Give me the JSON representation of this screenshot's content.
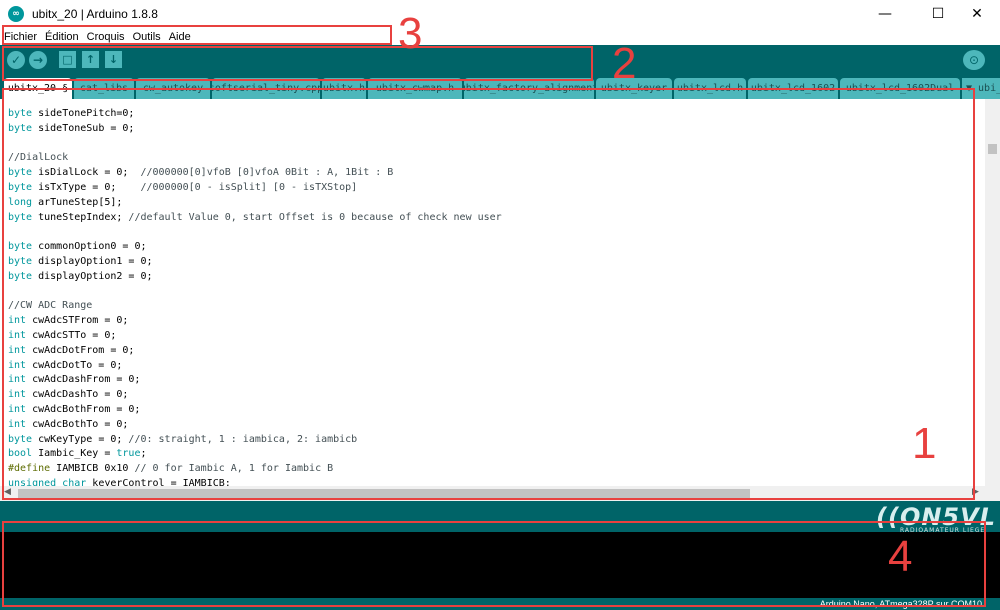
{
  "window": {
    "title": "ubitx_20 | Arduino 1.8.8",
    "minimize_glyph": "—",
    "maximize_glyph": "☐",
    "close_glyph": "✕"
  },
  "menu": [
    "Fichier",
    "Édition",
    "Croquis",
    "Outils",
    "Aide"
  ],
  "toolbar": {
    "verify_glyph": "✓",
    "upload_glyph": "→",
    "new_glyph": "□",
    "open_glyph": "↑",
    "save_glyph": "↓",
    "serial_glyph": "⊙"
  },
  "tabs": [
    "ubitx_20 §",
    "cat_libs",
    "cw_autokey",
    "softserial_tiny.cpp",
    "ubitx.h",
    "ubitx_cwmap.h",
    "ubitx_factory_alignment",
    "ubitx_keyer",
    "ubitx_lcd.h",
    "ubitx_lcd_1602",
    "ubitx_lcd_1602Dual",
    "▼ ubi_l"
  ],
  "code_lines": [
    [
      {
        "t": "byte",
        "c": "kw"
      },
      {
        "t": " sideTonePitch=0;"
      }
    ],
    [
      {
        "t": "byte",
        "c": "kw"
      },
      {
        "t": " sideToneSub = 0;"
      }
    ],
    [],
    [
      {
        "t": "//DialLock",
        "c": "cm"
      }
    ],
    [
      {
        "t": "byte",
        "c": "kw"
      },
      {
        "t": " isDialLock = 0;  "
      },
      {
        "t": "//000000[0]vfoB [0]vfoA 0Bit : A, 1Bit : B",
        "c": "cm"
      }
    ],
    [
      {
        "t": "byte",
        "c": "kw"
      },
      {
        "t": " isTxType = 0;    "
      },
      {
        "t": "//000000[0 - isSplit] [0 - isTXStop]",
        "c": "cm"
      }
    ],
    [
      {
        "t": "long",
        "c": "kw"
      },
      {
        "t": " arTuneStep[5];"
      }
    ],
    [
      {
        "t": "byte",
        "c": "kw"
      },
      {
        "t": " tuneStepIndex; "
      },
      {
        "t": "//default Value 0, start Offset is 0 because of check new user",
        "c": "cm"
      }
    ],
    [],
    [
      {
        "t": "byte",
        "c": "kw"
      },
      {
        "t": " commonOption0 = 0;"
      }
    ],
    [
      {
        "t": "byte",
        "c": "kw"
      },
      {
        "t": " displayOption1 = 0;"
      }
    ],
    [
      {
        "t": "byte",
        "c": "kw"
      },
      {
        "t": " displayOption2 = 0;"
      }
    ],
    [],
    [
      {
        "t": "//CW ADC Range",
        "c": "cm"
      }
    ],
    [
      {
        "t": "int",
        "c": "kw"
      },
      {
        "t": " cwAdcSTFrom = 0;"
      }
    ],
    [
      {
        "t": "int",
        "c": "kw"
      },
      {
        "t": " cwAdcSTTo = 0;"
      }
    ],
    [
      {
        "t": "int",
        "c": "kw"
      },
      {
        "t": " cwAdcDotFrom = 0;"
      }
    ],
    [
      {
        "t": "int",
        "c": "kw"
      },
      {
        "t": " cwAdcDotTo = 0;"
      }
    ],
    [
      {
        "t": "int",
        "c": "kw"
      },
      {
        "t": " cwAdcDashFrom = 0;"
      }
    ],
    [
      {
        "t": "int",
        "c": "kw"
      },
      {
        "t": " cwAdcDashTo = 0;"
      }
    ],
    [
      {
        "t": "int",
        "c": "kw"
      },
      {
        "t": " cwAdcBothFrom = 0;"
      }
    ],
    [
      {
        "t": "int",
        "c": "kw"
      },
      {
        "t": " cwAdcBothTo = 0;"
      }
    ],
    [
      {
        "t": "byte",
        "c": "kw"
      },
      {
        "t": " cwKeyType = 0; "
      },
      {
        "t": "//0: straight, 1 : iambica, 2: iambicb",
        "c": "cm"
      }
    ],
    [
      {
        "t": "bool",
        "c": "kw"
      },
      {
        "t": " Iambic_Key = "
      },
      {
        "t": "true",
        "c": "lit"
      },
      {
        "t": ";"
      }
    ],
    [
      {
        "t": "#define",
        "c": "pp"
      },
      {
        "t": " IAMBICB 0x10 "
      },
      {
        "t": "// 0 for Iambic A, 1 for Iambic B",
        "c": "cm"
      }
    ],
    [
      {
        "t": "unsigned char",
        "c": "kw"
      },
      {
        "t": " keyerControl = IAMBICB;"
      }
    ]
  ],
  "watermark": {
    "logo": "((ON5VL",
    "tagline": "RADIOAMATEUR LIEGE"
  },
  "status": {
    "board": "Arduino Nano, ATmega328P sur COM10"
  },
  "annotations": {
    "editor": "1",
    "toolbar": "2",
    "menu": "3",
    "console": "4"
  },
  "colors": {
    "teal_dark": "#006468",
    "teal_light": "#4db7bb",
    "annotation_red": "#e8413f",
    "keyword": "#00979c",
    "comment": "#434f54"
  }
}
